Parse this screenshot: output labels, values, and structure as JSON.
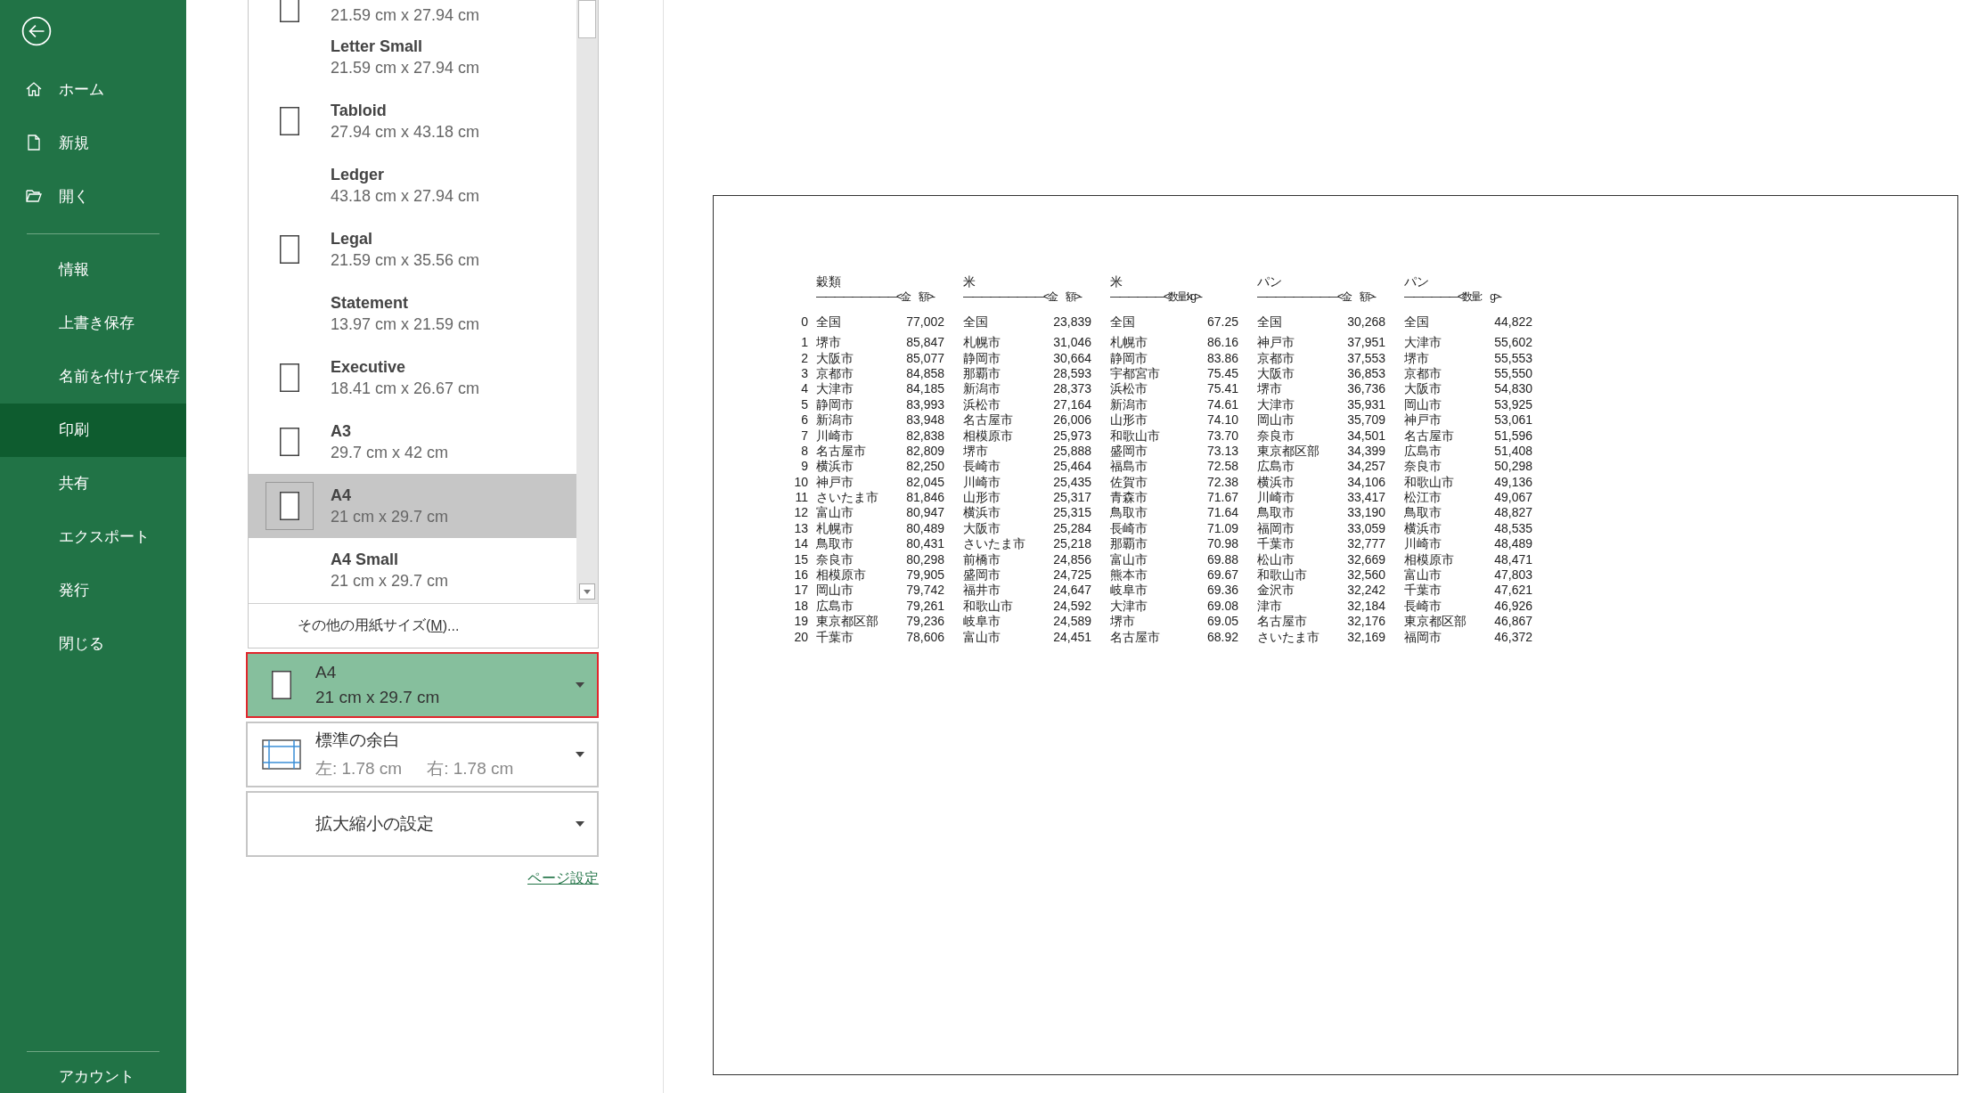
{
  "sidebar": {
    "back": {
      "kind": "back"
    },
    "top_items": [
      {
        "label": "ホーム",
        "kind": "home",
        "selected": false
      },
      {
        "label": "新規",
        "kind": "new",
        "selected": false
      },
      {
        "label": "開く",
        "kind": "open",
        "selected": false
      }
    ],
    "items": [
      {
        "label": "情報",
        "selected": false
      },
      {
        "label": "上書き保存",
        "selected": false
      },
      {
        "label": "名前を付けて保存",
        "selected": false
      },
      {
        "label": "印刷",
        "selected": true
      },
      {
        "label": "共有",
        "selected": false
      },
      {
        "label": "エクスポート",
        "selected": false
      },
      {
        "label": "発行",
        "selected": false
      },
      {
        "label": "閉じる",
        "selected": false
      }
    ],
    "bottom_items": [
      {
        "label": "アカウント",
        "selected": false
      }
    ]
  },
  "paper_list": {
    "items": [
      {
        "size": "21.59 cm x 27.94 cm",
        "kind": "portrait",
        "selected": false
      },
      {
        "name": "Letter Small",
        "size": "21.59 cm x 27.94 cm",
        "kind": "plain",
        "selected": false
      },
      {
        "name": "Tabloid",
        "size": "27.94 cm x 43.18 cm",
        "kind": "portrait",
        "selected": false
      },
      {
        "name": "Ledger",
        "size": "43.18 cm x 27.94 cm",
        "kind": "plain",
        "selected": false
      },
      {
        "name": "Legal",
        "size": "21.59 cm x 35.56 cm",
        "kind": "portrait",
        "selected": false
      },
      {
        "name": "Statement",
        "size": "13.97 cm x 21.59 cm",
        "kind": "plain",
        "selected": false
      },
      {
        "name": "Executive",
        "size": "18.41 cm x 26.67 cm",
        "kind": "portrait",
        "selected": false
      },
      {
        "name": "A3",
        "size": "29.7 cm x 42 cm",
        "kind": "portrait",
        "selected": false
      },
      {
        "name": "A4",
        "size": "21 cm x 29.7 cm",
        "kind": "portrait",
        "selected": true
      },
      {
        "name": "A4 Small",
        "size": "21 cm x 29.7 cm",
        "kind": "plain",
        "selected": false
      }
    ],
    "more": {
      "text": "その他の用紙サイズ(",
      "key": "M",
      "tail": ")..."
    }
  },
  "settings": [
    {
      "kind": "paper",
      "line1": "A4",
      "line2": "21 cm x 29.7 cm",
      "open": true
    },
    {
      "kind": "margins",
      "line1": "標準の余白",
      "line2": "左:  1.78 cm",
      "line3": "右:  1.78 cm",
      "open": false
    },
    {
      "kind": "scale",
      "line1": "拡大縮小の設定",
      "open": false
    }
  ],
  "page_setup_link": "ページ設定",
  "preview": {
    "groups": [
      {
        "title": "穀類",
        "subtitle": "―――――――――<金　額>-"
      },
      {
        "title": "米",
        "subtitle": "―――――――――<金　額>-"
      },
      {
        "title": "米",
        "subtitle": "――――――<数量:kg>-"
      },
      {
        "title": "パン",
        "subtitle": "―――――――――<金　額>-"
      },
      {
        "title": "パン",
        "subtitle": "――――――<数量:　g>-"
      }
    ],
    "rows": [
      {
        "kind": "total",
        "index": "0",
        "cells": [
          [
            "全国",
            "77,002"
          ],
          [
            "全国",
            "23,839"
          ],
          [
            "全国",
            "67.25"
          ],
          [
            "全国",
            "30,268"
          ],
          [
            "全国",
            "44,822"
          ]
        ]
      },
      {
        "kind": "rank",
        "index": "1",
        "cells": [
          [
            "堺市",
            "85,847"
          ],
          [
            "札幌市",
            "31,046"
          ],
          [
            "札幌市",
            "86.16"
          ],
          [
            "神戸市",
            "37,951"
          ],
          [
            "大津市",
            "55,602"
          ]
        ]
      },
      {
        "kind": "rank",
        "index": "2",
        "cells": [
          [
            "大阪市",
            "85,077"
          ],
          [
            "静岡市",
            "30,664"
          ],
          [
            "静岡市",
            "83.86"
          ],
          [
            "京都市",
            "37,553"
          ],
          [
            "堺市",
            "55,553"
          ]
        ]
      },
      {
        "kind": "rank",
        "index": "3",
        "cells": [
          [
            "京都市",
            "84,858"
          ],
          [
            "那覇市",
            "28,593"
          ],
          [
            "宇都宮市",
            "75.45"
          ],
          [
            "大阪市",
            "36,853"
          ],
          [
            "京都市",
            "55,550"
          ]
        ]
      },
      {
        "kind": "rank",
        "index": "4",
        "cells": [
          [
            "大津市",
            "84,185"
          ],
          [
            "新潟市",
            "28,373"
          ],
          [
            "浜松市",
            "75.41"
          ],
          [
            "堺市",
            "36,736"
          ],
          [
            "大阪市",
            "54,830"
          ]
        ]
      },
      {
        "kind": "rank",
        "index": "5",
        "cells": [
          [
            "静岡市",
            "83,993"
          ],
          [
            "浜松市",
            "27,164"
          ],
          [
            "新潟市",
            "74.61"
          ],
          [
            "大津市",
            "35,931"
          ],
          [
            "岡山市",
            "53,925"
          ]
        ]
      },
      {
        "kind": "rank",
        "index": "6",
        "cells": [
          [
            "新潟市",
            "83,948"
          ],
          [
            "名古屋市",
            "26,006"
          ],
          [
            "山形市",
            "74.10"
          ],
          [
            "岡山市",
            "35,709"
          ],
          [
            "神戸市",
            "53,061"
          ]
        ]
      },
      {
        "kind": "rank",
        "index": "7",
        "cells": [
          [
            "川崎市",
            "82,838"
          ],
          [
            "相模原市",
            "25,973"
          ],
          [
            "和歌山市",
            "73.70"
          ],
          [
            "奈良市",
            "34,501"
          ],
          [
            "名古屋市",
            "51,596"
          ]
        ]
      },
      {
        "kind": "rank",
        "index": "8",
        "cells": [
          [
            "名古屋市",
            "82,809"
          ],
          [
            "堺市",
            "25,888"
          ],
          [
            "盛岡市",
            "73.13"
          ],
          [
            "東京都区部",
            "34,399"
          ],
          [
            "広島市",
            "51,408"
          ]
        ]
      },
      {
        "kind": "rank",
        "index": "9",
        "cells": [
          [
            "横浜市",
            "82,250"
          ],
          [
            "長崎市",
            "25,464"
          ],
          [
            "福島市",
            "72.58"
          ],
          [
            "広島市",
            "34,257"
          ],
          [
            "奈良市",
            "50,298"
          ]
        ]
      },
      {
        "kind": "rank",
        "index": "10",
        "cells": [
          [
            "神戸市",
            "82,045"
          ],
          [
            "川崎市",
            "25,435"
          ],
          [
            "佐賀市",
            "72.38"
          ],
          [
            "横浜市",
            "34,106"
          ],
          [
            "和歌山市",
            "49,136"
          ]
        ]
      },
      {
        "kind": "rank",
        "index": "11",
        "cells": [
          [
            "さいたま市",
            "81,846"
          ],
          [
            "山形市",
            "25,317"
          ],
          [
            "青森市",
            "71.67"
          ],
          [
            "川崎市",
            "33,417"
          ],
          [
            "松江市",
            "49,067"
          ]
        ]
      },
      {
        "kind": "rank",
        "index": "12",
        "cells": [
          [
            "富山市",
            "80,947"
          ],
          [
            "横浜市",
            "25,315"
          ],
          [
            "鳥取市",
            "71.64"
          ],
          [
            "鳥取市",
            "33,190"
          ],
          [
            "鳥取市",
            "48,827"
          ]
        ]
      },
      {
        "kind": "rank",
        "index": "13",
        "cells": [
          [
            "札幌市",
            "80,489"
          ],
          [
            "大阪市",
            "25,284"
          ],
          [
            "長崎市",
            "71.09"
          ],
          [
            "福岡市",
            "33,059"
          ],
          [
            "横浜市",
            "48,535"
          ]
        ]
      },
      {
        "kind": "rank",
        "index": "14",
        "cells": [
          [
            "鳥取市",
            "80,431"
          ],
          [
            "さいたま市",
            "25,218"
          ],
          [
            "那覇市",
            "70.98"
          ],
          [
            "千葉市",
            "32,777"
          ],
          [
            "川崎市",
            "48,489"
          ]
        ]
      },
      {
        "kind": "rank",
        "index": "15",
        "cells": [
          [
            "奈良市",
            "80,298"
          ],
          [
            "前橋市",
            "24,856"
          ],
          [
            "富山市",
            "69.88"
          ],
          [
            "松山市",
            "32,669"
          ],
          [
            "相模原市",
            "48,471"
          ]
        ]
      },
      {
        "kind": "rank",
        "index": "16",
        "cells": [
          [
            "相模原市",
            "79,905"
          ],
          [
            "盛岡市",
            "24,725"
          ],
          [
            "熊本市",
            "69.67"
          ],
          [
            "和歌山市",
            "32,560"
          ],
          [
            "富山市",
            "47,803"
          ]
        ]
      },
      {
        "kind": "rank",
        "index": "17",
        "cells": [
          [
            "岡山市",
            "79,742"
          ],
          [
            "福井市",
            "24,647"
          ],
          [
            "岐阜市",
            "69.36"
          ],
          [
            "金沢市",
            "32,242"
          ],
          [
            "千葉市",
            "47,621"
          ]
        ]
      },
      {
        "kind": "rank",
        "index": "18",
        "cells": [
          [
            "広島市",
            "79,261"
          ],
          [
            "和歌山市",
            "24,592"
          ],
          [
            "大津市",
            "69.08"
          ],
          [
            "津市",
            "32,184"
          ],
          [
            "長崎市",
            "46,926"
          ]
        ]
      },
      {
        "kind": "rank",
        "index": "19",
        "cells": [
          [
            "東京都区部",
            "79,236"
          ],
          [
            "岐阜市",
            "24,589"
          ],
          [
            "堺市",
            "69.05"
          ],
          [
            "名古屋市",
            "32,176"
          ],
          [
            "東京都区部",
            "46,867"
          ]
        ]
      },
      {
        "kind": "rank",
        "index": "20",
        "cells": [
          [
            "千葉市",
            "78,606"
          ],
          [
            "富山市",
            "24,451"
          ],
          [
            "名古屋市",
            "68.92"
          ],
          [
            "さいたま市",
            "32,169"
          ],
          [
            "福岡市",
            "46,372"
          ]
        ]
      }
    ]
  }
}
